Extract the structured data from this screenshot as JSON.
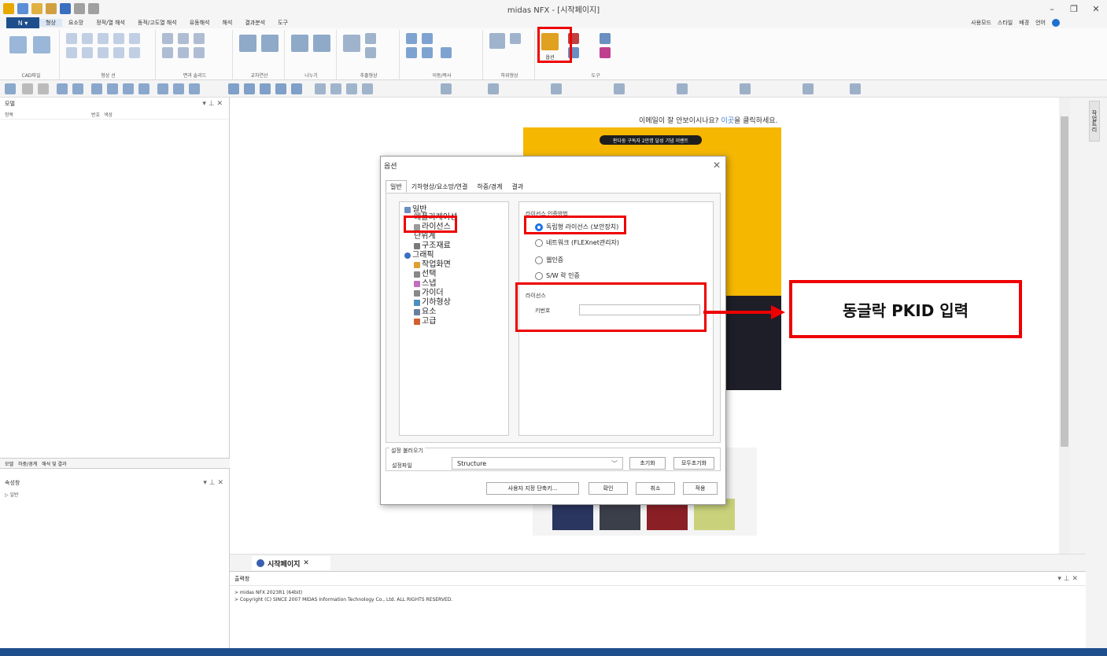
{
  "window": {
    "title": "midas NFX - [시작페이지]"
  },
  "menu": {
    "items": [
      "형상",
      "요소망",
      "정적/열 해석",
      "동적/고도열 해석",
      "유동해석",
      "해석",
      "결과분석",
      "도구"
    ],
    "active": "형상",
    "right": [
      "사용모드",
      "스타일",
      "배경",
      "언어"
    ]
  },
  "ribbon": {
    "groups": [
      "CAD파일",
      "형상 선",
      "면과 솔리드",
      "교차연산",
      "나누기",
      "추출형상",
      "이동/복사",
      "하위형상",
      "도구"
    ],
    "options_label": "옵션"
  },
  "left_panel": {
    "top_title": "모델",
    "columns": [
      "항목",
      "번호",
      "색상"
    ],
    "bottom_tabs": [
      "모델",
      "하중/경계",
      "해석 및 결과"
    ],
    "props_title": "속성창",
    "props_item": "일반"
  },
  "start_page": {
    "message_pre": "이메일이 잘 안보이시나요? ",
    "message_link": "이곳",
    "message_post": "을 클릭하세요.",
    "banner_line": "판다둥 구독자 2만명 달성 기념 이벤트"
  },
  "doc_tab": {
    "label": "시작페이지"
  },
  "output": {
    "title": "출력창",
    "lines": [
      "> midas NFX 2023R1 (64bit)",
      "> Copyright (C) SINCE 2007 MIDAS Information Technology Co., Ltd. ALL RIGHTS RESERVED."
    ]
  },
  "right_strip": {
    "label": "작업트리"
  },
  "dialog": {
    "title": "옵션",
    "tabs": [
      "일반",
      "기하형상/요소망/연결",
      "하중/경계",
      "결과"
    ],
    "tree": [
      "일반",
      "애플리케이션",
      "라이선스",
      "단위계",
      "구조재료",
      "그래픽",
      "작업화면",
      "선택",
      "스냅",
      "가이더",
      "기하형상",
      "요소",
      "고급"
    ],
    "license_method_title": "라이선스 인증방법",
    "radios": [
      "독립형 라이선스 (보안장치)",
      "네트워크 (FLEXnet관리자)",
      "웹인증",
      "S/W 락 인증"
    ],
    "license_group_title": "라이선스",
    "key_label": "키번호",
    "key_value": "",
    "load_section_title": "설정 불러오기",
    "settings_file_label": "설정파일",
    "settings_file_value": "Structure",
    "btn_reset": "초기화",
    "btn_reset_all": "모두초기화",
    "btn_shortcut": "사용자 지정 단축키...",
    "btn_ok": "확인",
    "btn_cancel": "취소",
    "btn_apply": "적용"
  },
  "callout": {
    "text": "동글락 PKID 입력"
  },
  "colors": {
    "highlight": "#ee0000",
    "app_blue": "#1f4e8c",
    "banner_yellow": "#f5b700",
    "radio_selected": "#1a73e8"
  }
}
